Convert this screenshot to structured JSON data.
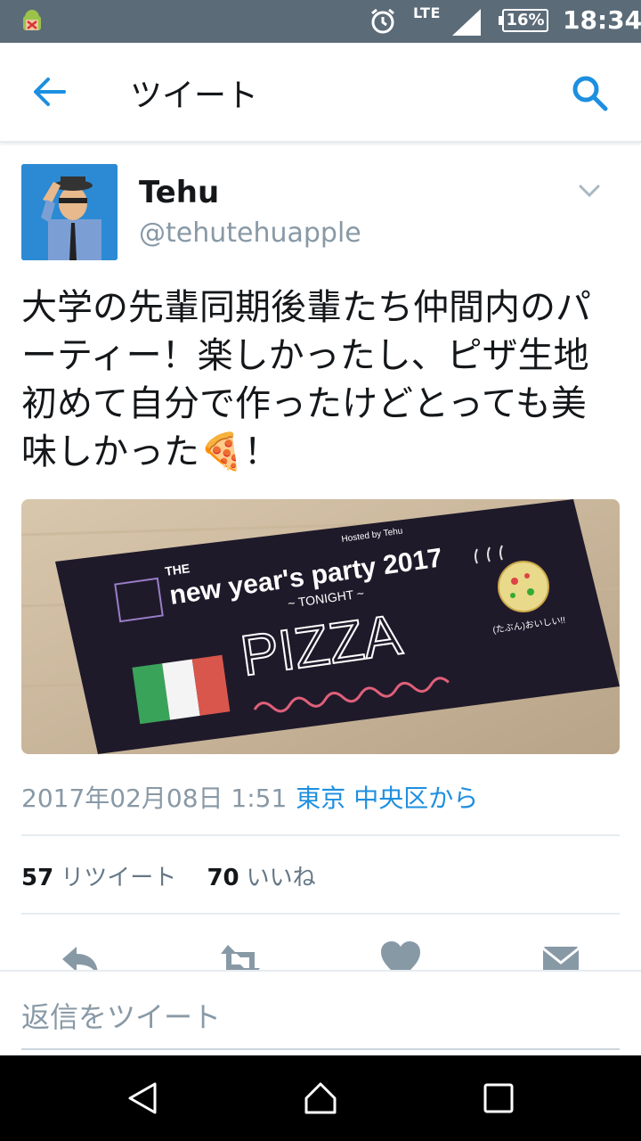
{
  "status_bar": {
    "network": "LTE",
    "battery": "16%",
    "time": "18:34"
  },
  "header": {
    "title": "ツイート"
  },
  "tweet": {
    "user_name": "Tehu",
    "user_handle": "@tehutehuapple",
    "text": "大学の先輩同期後輩たち仲間内のパーティー！楽しかったし、ピザ生地初めて自分で作ったけどとっても美味しかった🍕！",
    "image": {
      "title_small": "Hosted by Tehu",
      "title_the": "THE",
      "title_main": "new year's party 2017",
      "tonight": "~ TONIGHT ~",
      "pizza": "PIZZA",
      "note": "(たぶん)おいしい!!"
    },
    "timestamp": "2017年02月08日 1:51",
    "location": "東京 中央区から",
    "retweet_count": "57",
    "retweet_label": "リツイート",
    "like_count": "70",
    "like_label": "いいね"
  },
  "reply": {
    "placeholder": "返信をツイート"
  },
  "colors": {
    "status_bar": "#5b6b78",
    "accent": "#1d8fe0",
    "secondary_text": "#8899a6"
  }
}
